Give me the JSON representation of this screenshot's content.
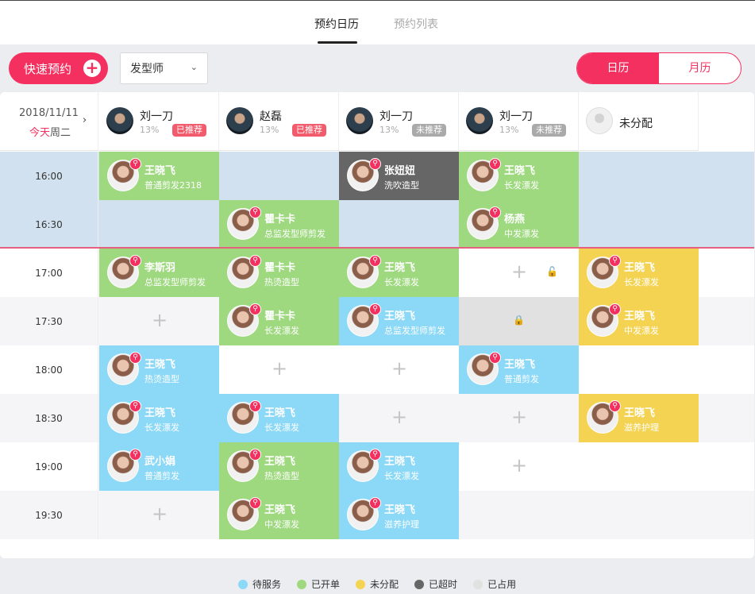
{
  "tabs": [
    {
      "label": "预约日历",
      "active": true
    },
    {
      "label": "预约列表",
      "active": false
    }
  ],
  "toolbar": {
    "quick_book": "快速预约",
    "plus": "+",
    "role_select": "发型师",
    "chevron": "⌄",
    "view_day": "日历",
    "view_month": "月历"
  },
  "date_header": {
    "date": "2018/11/11",
    "today": "今天",
    "weekday": "周二",
    "next": "›"
  },
  "staff": [
    {
      "name": "刘一刀",
      "pct": "13%",
      "badge": "已推荐",
      "badge_color": "#f25b6c",
      "avatar": "stylist-avatar"
    },
    {
      "name": "赵磊",
      "pct": "13%",
      "badge": "已推荐",
      "badge_color": "#f25b6c",
      "avatar": "stylist-avatar"
    },
    {
      "name": "刘一刀",
      "pct": "13%",
      "badge": "未推荐",
      "badge_color": "#aaaaaa",
      "avatar": "stylist-avatar"
    },
    {
      "name": "刘一刀",
      "pct": "13%",
      "badge": "未推荐",
      "badge_color": "#aaaaaa",
      "avatar": "stylist-avatar"
    },
    {
      "name": "未分配",
      "pct": "",
      "badge": "",
      "badge_color": "",
      "avatar": "unassigned-avatar"
    }
  ],
  "times": [
    "16:00",
    "16:30",
    "17:00",
    "17:30",
    "18:00",
    "18:30",
    "19:00",
    "19:30"
  ],
  "appointments": {
    "r0c0": {
      "name": "王晓飞",
      "service": "普通剪发2318"
    },
    "r0c2": {
      "name": "张妞妞",
      "service": "洗吹造型"
    },
    "r0c3": {
      "name": "王晓飞",
      "service": "长发漂发"
    },
    "r1c1": {
      "name": "瞿卡卡",
      "service": "总监发型师剪发"
    },
    "r1c3": {
      "name": "杨燕",
      "service": "中发漂发"
    },
    "r2c0": {
      "name": "李斯羽",
      "service": "总监发型师剪发"
    },
    "r2c1": {
      "name": "瞿卡卡",
      "service": "热烫造型"
    },
    "r2c2": {
      "name": "王晓飞",
      "service": "长发漂发"
    },
    "r2c4": {
      "name": "王晓飞",
      "service": "长发漂发"
    },
    "r3c1": {
      "name": "瞿卡卡",
      "service": "长发漂发"
    },
    "r3c2": {
      "name": "王晓飞",
      "service": "总监发型师剪发"
    },
    "r3c4": {
      "name": "王晓飞",
      "service": "中发漂发"
    },
    "r4c0": {
      "name": "王晓飞",
      "service": "热烫造型"
    },
    "r4c3": {
      "name": "王晓飞",
      "service": "普通剪发"
    },
    "r5c0": {
      "name": "王晓飞",
      "service": "长发漂发"
    },
    "r5c1": {
      "name": "王晓飞",
      "service": "长发漂发"
    },
    "r5c4": {
      "name": "王晓飞",
      "service": "滋养护理"
    },
    "r6c0": {
      "name": "武小娟",
      "service": "普通剪发"
    },
    "r6c1": {
      "name": "王晓飞",
      "service": "热烫造型"
    },
    "r6c2": {
      "name": "王晓飞",
      "service": "长发漂发"
    },
    "r7c1": {
      "name": "王晓飞",
      "service": "中发漂发"
    },
    "r7c2": {
      "name": "王晓飞",
      "service": "滋养护理"
    }
  },
  "icons": {
    "add": "+",
    "lock": "🔓",
    "lock_closed": "🔒",
    "tag": "⚲"
  },
  "legend": [
    {
      "label": "待服务",
      "color": "#8bd8f7"
    },
    {
      "label": "已开单",
      "color": "#9ed97f"
    },
    {
      "label": "未分配",
      "color": "#f5d352"
    },
    {
      "label": "已超时",
      "color": "#666666"
    },
    {
      "label": "已占用",
      "color": "#e1e1e1"
    }
  ]
}
